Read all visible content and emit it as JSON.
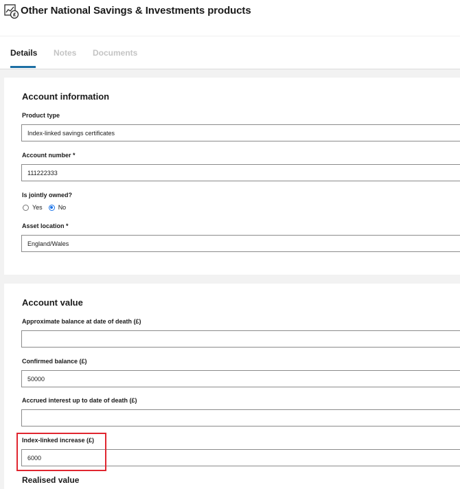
{
  "header": {
    "icon": "savings-chart-pound-icon",
    "title": "Other National Savings & Investments products"
  },
  "tabs": [
    {
      "label": "Details",
      "active": true
    },
    {
      "label": "Notes",
      "active": false
    },
    {
      "label": "Documents",
      "active": false
    }
  ],
  "account_information": {
    "title": "Account information",
    "product_type": {
      "label": "Product type",
      "value": "Index-linked savings certificates"
    },
    "account_number": {
      "label": "Account number *",
      "value": "111222333"
    },
    "jointly_owned": {
      "label": "Is jointly owned?",
      "options": [
        {
          "label": "Yes",
          "selected": false
        },
        {
          "label": "No",
          "selected": true
        }
      ]
    },
    "asset_location": {
      "label": "Asset location *",
      "value": "England/Wales"
    }
  },
  "account_value": {
    "title": "Account value",
    "approx_balance": {
      "label": "Approximate balance at date of death (£)",
      "value": ""
    },
    "confirmed_balance": {
      "label": "Confirmed balance (£)",
      "value": "50000"
    },
    "accrued_interest": {
      "label": "Accrued interest up to date of death (£)",
      "value": ""
    },
    "index_linked_increase": {
      "label": "Index-linked increase (£)",
      "value": "6000"
    }
  },
  "realised_value": {
    "title": "Realised value"
  },
  "colors": {
    "accent": "#1b6ea3",
    "radio_selected": "#1a73e8",
    "highlight": "#e0252f",
    "page_background": "#f2f2f2"
  }
}
